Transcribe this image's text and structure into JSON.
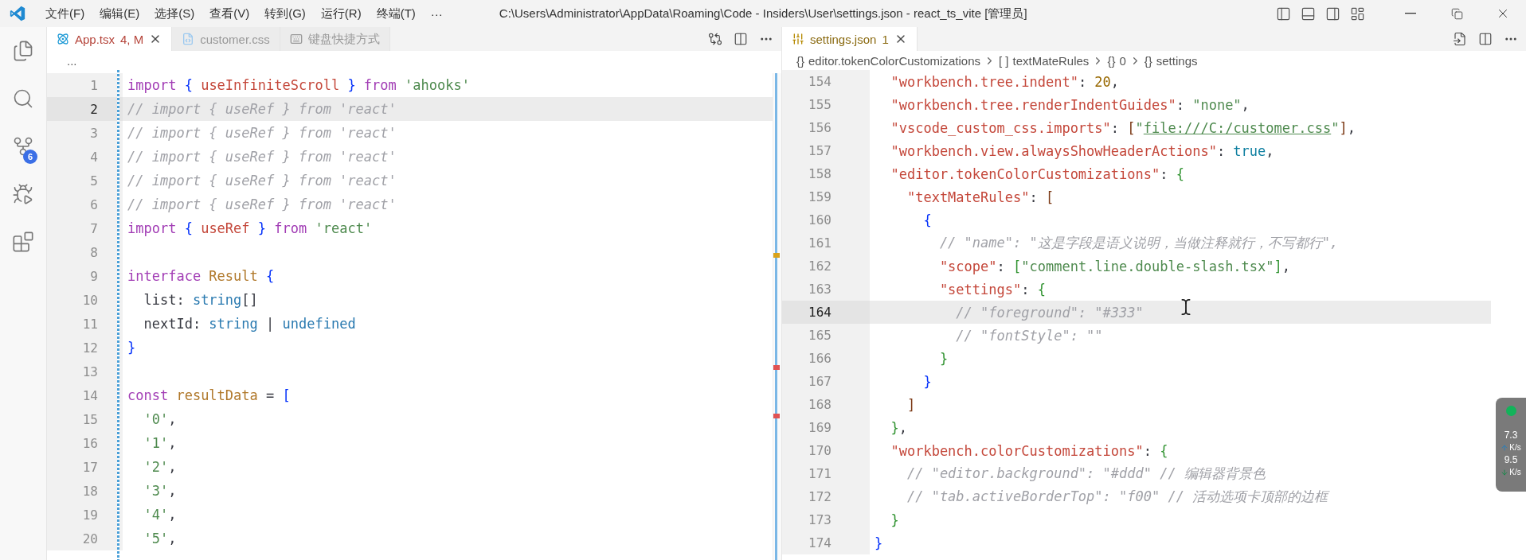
{
  "title_bar": {
    "menus": [
      "文件(F)",
      "编辑(E)",
      "选择(S)",
      "查看(V)",
      "转到(G)",
      "运行(R)",
      "终端(T)"
    ],
    "more": "···",
    "title": "C:\\Users\\Administrator\\AppData\\Roaming\\Code - Insiders\\User\\settings.json - react_ts_vite [管理员]"
  },
  "activity_bar": {
    "items": [
      {
        "kind": "explorer"
      },
      {
        "kind": "search"
      },
      {
        "kind": "source-control",
        "badge": "6"
      },
      {
        "kind": "run-debug"
      },
      {
        "kind": "extensions"
      }
    ]
  },
  "left_editor": {
    "tabs": [
      {
        "label": "App.tsx",
        "kind": "react",
        "status": "4, M",
        "has_errors": true,
        "selected": true
      },
      {
        "label": "customer.css",
        "kind": "css",
        "selected": false
      },
      {
        "label": "键盘快捷方式",
        "kind": "keyboard",
        "selected": false
      }
    ],
    "breadcrumb": "...",
    "lines": [
      {
        "n": "1",
        "current": false,
        "tokens": [
          {
            "text": "import ",
            "kind": "kw"
          },
          {
            "text": "{",
            "kind": "bracket1"
          },
          {
            "text": " useInfiniteScroll ",
            "kind": "var"
          },
          {
            "text": "}",
            "kind": "bracket1"
          },
          {
            "text": " from ",
            "kind": "kw"
          },
          {
            "text": "'ahooks'",
            "kind": "str"
          }
        ]
      },
      {
        "n": "2",
        "current": true,
        "tokens": [
          {
            "text": "// import { useRef } from 'react'",
            "kind": "comment"
          }
        ]
      },
      {
        "n": "3",
        "current": false,
        "tokens": [
          {
            "text": "// import { useRef } from 'react'",
            "kind": "comment"
          }
        ]
      },
      {
        "n": "4",
        "current": false,
        "tokens": [
          {
            "text": "// import { useRef } from 'react'",
            "kind": "comment"
          }
        ]
      },
      {
        "n": "5",
        "current": false,
        "tokens": [
          {
            "text": "// import { useRef } from 'react'",
            "kind": "comment"
          }
        ]
      },
      {
        "n": "6",
        "current": false,
        "tokens": [
          {
            "text": "// import { useRef } from 'react'",
            "kind": "comment"
          }
        ]
      },
      {
        "n": "7",
        "current": false,
        "tokens": [
          {
            "text": "import ",
            "kind": "kw"
          },
          {
            "text": "{",
            "kind": "bracket1"
          },
          {
            "text": " useRef ",
            "kind": "var"
          },
          {
            "text": "}",
            "kind": "bracket1"
          },
          {
            "text": " from ",
            "kind": "kw"
          },
          {
            "text": "'react'",
            "kind": "str"
          }
        ]
      },
      {
        "n": "8",
        "current": false
      },
      {
        "n": "9",
        "current": false,
        "tokens": [
          {
            "text": "interface ",
            "kind": "kw"
          },
          {
            "text": "Result ",
            "kind": "type"
          },
          {
            "text": "{",
            "kind": "bracket1"
          }
        ]
      },
      {
        "n": "10",
        "current": false,
        "tokens": [
          {
            "text": "  list: ",
            "kind": "plain"
          },
          {
            "text": "string",
            "kind": "prim"
          },
          {
            "text": "[]",
            "kind": "plain"
          }
        ]
      },
      {
        "n": "11",
        "current": false,
        "tokens": [
          {
            "text": "  nextId: ",
            "kind": "plain"
          },
          {
            "text": "string",
            "kind": "prim"
          },
          {
            "text": " | ",
            "kind": "plain"
          },
          {
            "text": "undefined",
            "kind": "prim"
          }
        ]
      },
      {
        "n": "12",
        "current": false,
        "tokens": [
          {
            "text": "}",
            "kind": "bracket1"
          }
        ]
      },
      {
        "n": "13",
        "current": false
      },
      {
        "n": "14",
        "current": false,
        "tokens": [
          {
            "text": "const ",
            "kind": "kw"
          },
          {
            "text": "resultData",
            "kind": "type"
          },
          {
            "text": " = ",
            "kind": "plain"
          },
          {
            "text": "[",
            "kind": "bracket1"
          }
        ]
      },
      {
        "n": "15",
        "current": false,
        "tokens": [
          {
            "text": "  '0'",
            "kind": "str"
          },
          {
            "text": ",",
            "kind": "plain"
          }
        ]
      },
      {
        "n": "16",
        "current": false,
        "tokens": [
          {
            "text": "  '1'",
            "kind": "str"
          },
          {
            "text": ",",
            "kind": "plain"
          }
        ]
      },
      {
        "n": "17",
        "current": false,
        "tokens": [
          {
            "text": "  '2'",
            "kind": "str"
          },
          {
            "text": ",",
            "kind": "plain"
          }
        ]
      },
      {
        "n": "18",
        "current": false,
        "tokens": [
          {
            "text": "  '3'",
            "kind": "str"
          },
          {
            "text": ",",
            "kind": "plain"
          }
        ]
      },
      {
        "n": "19",
        "current": false,
        "tokens": [
          {
            "text": "  '4'",
            "kind": "str"
          },
          {
            "text": ",",
            "kind": "plain"
          }
        ]
      },
      {
        "n": "20",
        "current": false,
        "tokens": [
          {
            "text": "  '5'",
            "kind": "str"
          },
          {
            "text": ",",
            "kind": "plain"
          }
        ]
      }
    ]
  },
  "right_editor": {
    "tabs": [
      {
        "label": "settings.json",
        "kind": "settings",
        "status": "1",
        "has_errors": false,
        "selected": true
      }
    ],
    "breadcrumbs": [
      {
        "symbol": "{}",
        "label": "editor.tokenColorCustomizations"
      },
      {
        "symbol": "[ ]",
        "label": "textMateRules"
      },
      {
        "symbol": "{}",
        "label": "0"
      },
      {
        "symbol": "{}",
        "label": "settings"
      }
    ],
    "lines": [
      {
        "n": "154",
        "current": false,
        "tokens": [
          {
            "text": "  \"workbench.tree.indent\"",
            "kind": "key"
          },
          {
            "text": ": ",
            "kind": "plain"
          },
          {
            "text": "20",
            "kind": "num"
          },
          {
            "text": ",",
            "kind": "plain"
          }
        ]
      },
      {
        "n": "155",
        "current": false,
        "tokens": [
          {
            "text": "  \"workbench.tree.renderIndentGuides\"",
            "kind": "key"
          },
          {
            "text": ": ",
            "kind": "plain"
          },
          {
            "text": "\"none\"",
            "kind": "str"
          },
          {
            "text": ",",
            "kind": "plain"
          }
        ]
      },
      {
        "n": "156",
        "current": false,
        "tokens": [
          {
            "text": "  \"vscode_custom_css.imports\"",
            "kind": "key"
          },
          {
            "text": ": ",
            "kind": "plain"
          },
          {
            "text": "[",
            "kind": "bracket3"
          },
          {
            "text": "\"",
            "kind": "str"
          },
          {
            "text": "file:///C:/customer.css",
            "kind": "link"
          },
          {
            "text": "\"",
            "kind": "str"
          },
          {
            "text": "]",
            "kind": "bracket3"
          },
          {
            "text": ",",
            "kind": "plain"
          }
        ]
      },
      {
        "n": "157",
        "current": false,
        "tokens": [
          {
            "text": "  \"workbench.view.alwaysShowHeaderActions\"",
            "kind": "key"
          },
          {
            "text": ": ",
            "kind": "plain"
          },
          {
            "text": "true",
            "kind": "bool"
          },
          {
            "text": ",",
            "kind": "plain"
          }
        ]
      },
      {
        "n": "158",
        "current": false,
        "tokens": [
          {
            "text": "  \"editor.tokenColorCustomizations\"",
            "kind": "key"
          },
          {
            "text": ": ",
            "kind": "plain"
          },
          {
            "text": "{",
            "kind": "bracket2"
          }
        ]
      },
      {
        "n": "159",
        "current": false,
        "tokens": [
          {
            "text": "    \"textMateRules\"",
            "kind": "key"
          },
          {
            "text": ": ",
            "kind": "plain"
          },
          {
            "text": "[",
            "kind": "bracket3"
          }
        ]
      },
      {
        "n": "160",
        "current": false,
        "tokens": [
          {
            "text": "      {",
            "kind": "bracket1"
          }
        ]
      },
      {
        "n": "161",
        "current": false,
        "tokens": [
          {
            "text": "        // \"name\": \"这是字段是语义说明，当做注释就行，不写都行\",",
            "kind": "comment"
          }
        ]
      },
      {
        "n": "162",
        "current": false,
        "tokens": [
          {
            "text": "        \"scope\"",
            "kind": "key"
          },
          {
            "text": ": ",
            "kind": "plain"
          },
          {
            "text": "[",
            "kind": "bracket2"
          },
          {
            "text": "\"comment.line.double-slash.tsx\"",
            "kind": "str"
          },
          {
            "text": "]",
            "kind": "bracket2"
          },
          {
            "text": ",",
            "kind": "plain"
          }
        ]
      },
      {
        "n": "163",
        "current": false,
        "tokens": [
          {
            "text": "        \"settings\"",
            "kind": "key"
          },
          {
            "text": ": ",
            "kind": "plain"
          },
          {
            "text": "{",
            "kind": "bracket2"
          }
        ]
      },
      {
        "n": "164",
        "current": true,
        "tokens": [
          {
            "text": "          // \"foreground\": \"#333\"",
            "kind": "comment"
          }
        ]
      },
      {
        "n": "165",
        "current": false,
        "tokens": [
          {
            "text": "          // \"fontStyle\": \"\"",
            "kind": "comment"
          }
        ]
      },
      {
        "n": "166",
        "current": false,
        "tokens": [
          {
            "text": "        }",
            "kind": "bracket2"
          }
        ]
      },
      {
        "n": "167",
        "current": false,
        "tokens": [
          {
            "text": "      }",
            "kind": "bracket1"
          }
        ]
      },
      {
        "n": "168",
        "current": false,
        "tokens": [
          {
            "text": "    ]",
            "kind": "bracket3"
          }
        ]
      },
      {
        "n": "169",
        "current": false,
        "tokens": [
          {
            "text": "  }",
            "kind": "bracket2"
          },
          {
            "text": ",",
            "kind": "plain"
          }
        ]
      },
      {
        "n": "170",
        "current": false,
        "tokens": [
          {
            "text": "  \"workbench.colorCustomizations\"",
            "kind": "key"
          },
          {
            "text": ": ",
            "kind": "plain"
          },
          {
            "text": "{",
            "kind": "bracket2"
          }
        ]
      },
      {
        "n": "171",
        "current": false,
        "tokens": [
          {
            "text": "    // \"editor.background\": \"#ddd\" // 编辑器背景色",
            "kind": "comment"
          }
        ]
      },
      {
        "n": "172",
        "current": false,
        "tokens": [
          {
            "text": "    // \"tab.activeBorderTop\": \"f00\" // 活动选项卡顶部的边框",
            "kind": "comment"
          }
        ]
      },
      {
        "n": "173",
        "current": false,
        "tokens": [
          {
            "text": "  }",
            "kind": "bracket2"
          }
        ]
      },
      {
        "n": "174",
        "current": false,
        "tokens": [
          {
            "text": "}",
            "kind": "bracket1"
          }
        ]
      }
    ]
  },
  "net_speed": {
    "up": {
      "value": "7.3",
      "unit": "K/s"
    },
    "down": {
      "value": "9.5",
      "unit": "K/s"
    }
  }
}
